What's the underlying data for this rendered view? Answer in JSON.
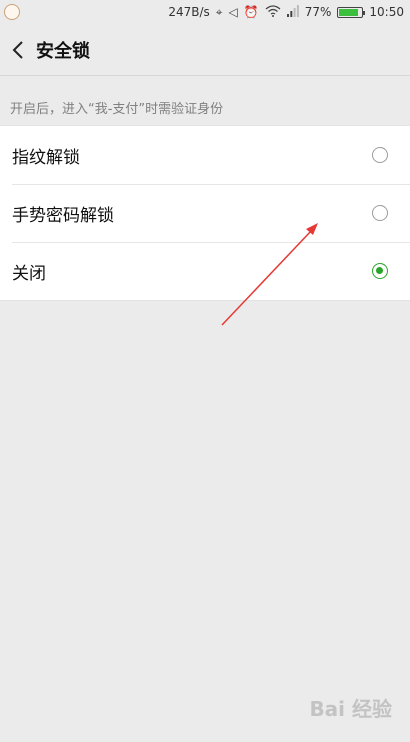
{
  "status_bar": {
    "speed": "247B/s",
    "battery": "77%",
    "time": "10:50"
  },
  "header": {
    "title": "安全锁"
  },
  "hint": "开启后，进入“我-支付”时需验证身份",
  "options": [
    {
      "label": "指纹解锁",
      "checked": false
    },
    {
      "label": "手势密码解锁",
      "checked": false
    },
    {
      "label": "关闭",
      "checked": true
    }
  ],
  "watermark": "Bai 经验",
  "colors": {
    "accent": "#2aa52a",
    "background": "#ebebeb",
    "annotation_arrow": "#e53935"
  }
}
